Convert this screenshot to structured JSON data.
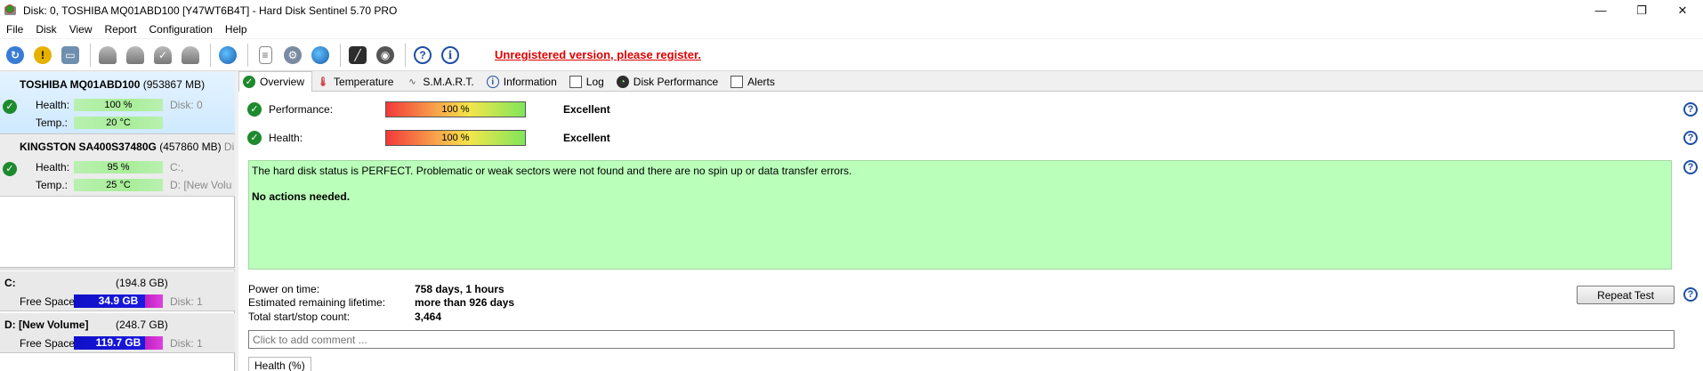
{
  "window": {
    "title": "Disk: 0, TOSHIBA MQ01ABD100 [Y47WT6B4T]  -  Hard Disk Sentinel 5.70 PRO",
    "controls": {
      "minimize": "—",
      "maximize": "❐",
      "close": "✕"
    }
  },
  "menu": [
    "File",
    "Disk",
    "View",
    "Report",
    "Configuration",
    "Help"
  ],
  "toolbar": {
    "icons": [
      "refresh-icon",
      "alert-icon",
      "disk-info-icon",
      "surface-test-icon",
      "disk-test-icon",
      "test-ok-icon",
      "test-ext-icon",
      "web-icon",
      "report-icon",
      "settings-icon",
      "network-icon",
      "performance-chart-icon",
      "sound-icon",
      "help-icon",
      "info-icon"
    ],
    "unregistered_text": "Unregistered version, please register."
  },
  "disks": [
    {
      "model": "TOSHIBA MQ01ABD100",
      "size": "(953867 MB)",
      "health_label": "Health:",
      "health": "100 %",
      "health_pct": 100,
      "temp_label": "Temp.:",
      "temp": "20 °C",
      "aux1": "Disk: 0",
      "aux2": ""
    },
    {
      "model": "KINGSTON SA400S37480G",
      "size": "(457860 MB)",
      "size_tail": "Di",
      "health_label": "Health:",
      "health": "95 %",
      "health_pct": 95,
      "temp_label": "Temp.:",
      "temp": "25 °C",
      "aux1": "C:,",
      "aux2": "D: [New Volu"
    }
  ],
  "volumes": [
    {
      "name": "C:",
      "size": "(194.8 GB)",
      "free_label": "Free Space",
      "free": "34.9 GB",
      "disk": "Disk: 1"
    },
    {
      "name": "D: [New Volume]",
      "size": "(248.7 GB)",
      "free_label": "Free Space",
      "free": "119.7 GB",
      "disk": "Disk: 1"
    }
  ],
  "tabs": [
    "Overview",
    "Temperature",
    "S.M.A.R.T.",
    "Information",
    "Log",
    "Disk Performance",
    "Alerts"
  ],
  "overview": {
    "performance_label": "Performance:",
    "performance": "100 %",
    "performance_pct": 100,
    "performance_rating": "Excellent",
    "health_label": "Health:",
    "health": "100 %",
    "health_pct": 100,
    "health_rating": "Excellent",
    "status_line1": "The hard disk status is PERFECT. Problematic or weak sectors were not found and there are no spin up or data transfer errors.",
    "status_line2": "No actions needed.",
    "power_on_label": "Power on time:",
    "power_on": "758 days, 1 hours",
    "lifetime_label": "Estimated remaining lifetime:",
    "lifetime": "more than 926 days",
    "startstop_label": "Total start/stop count:",
    "startstop": "3,464",
    "repeat_button": "Repeat Test",
    "comment_placeholder": "Click to add comment ...",
    "health_chart_tab": "Health (%)"
  },
  "colors": {
    "status_bg": "#baffba",
    "unregistered": "#e00000",
    "free_bar": "#1a1adf",
    "ok_green": "#1e8a2e"
  }
}
